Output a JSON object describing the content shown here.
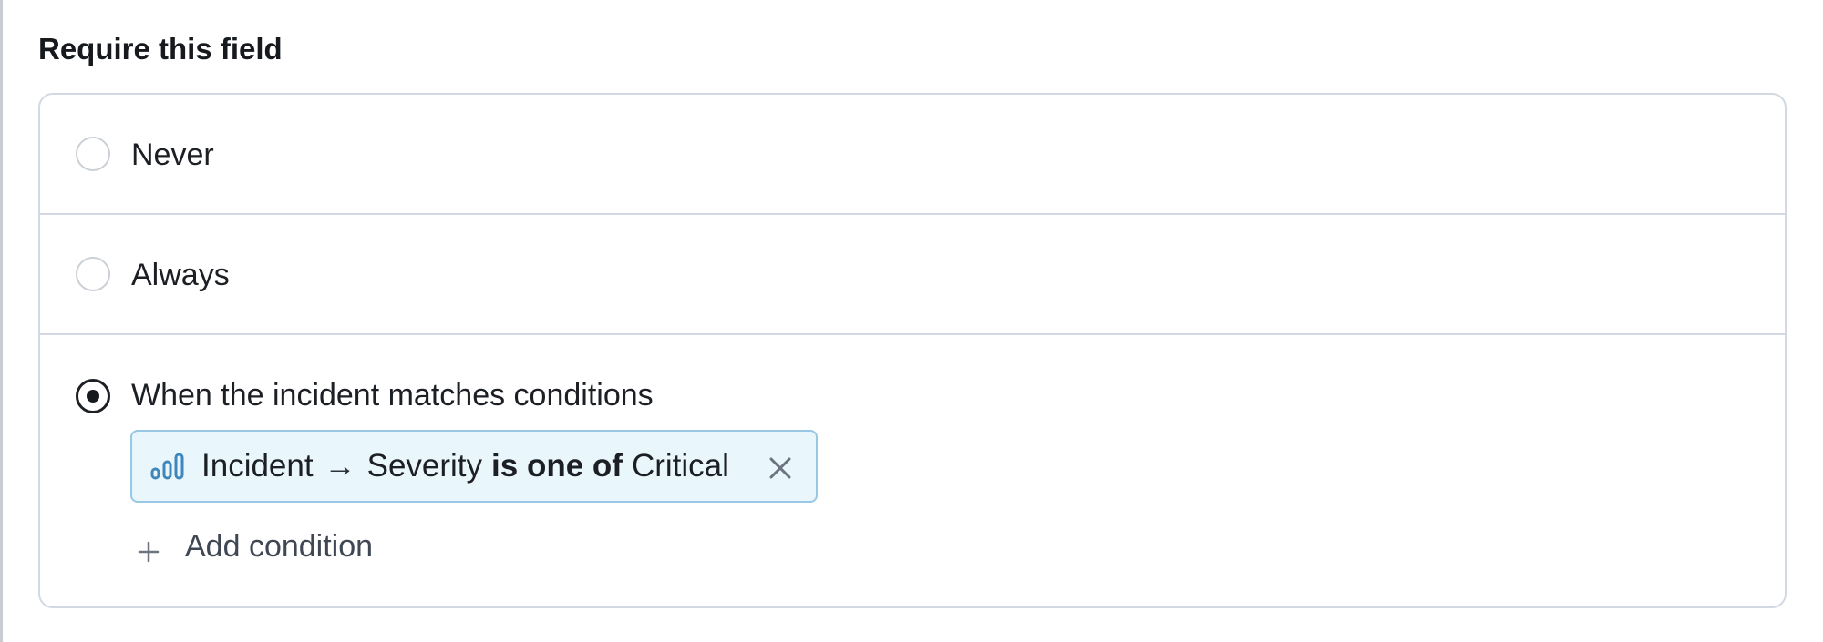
{
  "section": {
    "title": "Require this field"
  },
  "options": {
    "never": {
      "label": "Never",
      "selected": false
    },
    "always": {
      "label": "Always",
      "selected": false
    },
    "conditions": {
      "label": "When the incident matches conditions",
      "selected": true
    }
  },
  "condition_chip": {
    "icon": "severity-bars-icon",
    "subject": "Incident",
    "arrow": "→",
    "field": "Severity",
    "operator": "is one of",
    "value": "Critical",
    "remove_icon": "close-icon"
  },
  "add_condition": {
    "label": "Add condition",
    "icon": "plus-icon"
  },
  "colors": {
    "chip_background": "#e9f6fc",
    "chip_border": "#98c8e4",
    "icon_blue": "#3f86ba",
    "card_border": "#d3d9e2"
  }
}
